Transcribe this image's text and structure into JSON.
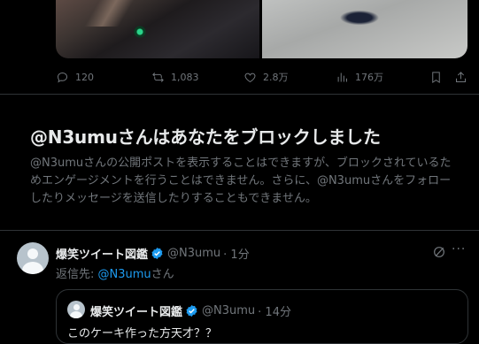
{
  "top_tweet": {
    "stats": {
      "replies": "120",
      "retweets": "1,083",
      "likes": "2.8万",
      "views": "176万"
    }
  },
  "block_notice": {
    "title": "@N3umuさんはあなたをブロックしました",
    "description": "@N3umuさんの公開ポストを表示することはできますが、ブロックされているためエンゲージメントを行うことはできません。さらに、@N3umuさんをフォローしたりメッセージを送信したりすることもできません。"
  },
  "reply_tweet": {
    "display_name": "爆笑ツイート図鑑",
    "handle": "@N3umu",
    "time": "· 1分",
    "reply_prefix": "返信先: ",
    "reply_handle": "@N3umu",
    "reply_suffix": "さん",
    "more_label": "···"
  },
  "quoted_tweet": {
    "display_name": "爆笑ツイート図鑑",
    "handle": "@N3umu",
    "time": "· 14分",
    "text": "このケーキ作った方天才？？"
  },
  "colors": {
    "background": "#000000",
    "text": "#e7e9ea",
    "muted": "#71767b",
    "accent": "#1d9bf0",
    "divider": "#2f3336"
  }
}
